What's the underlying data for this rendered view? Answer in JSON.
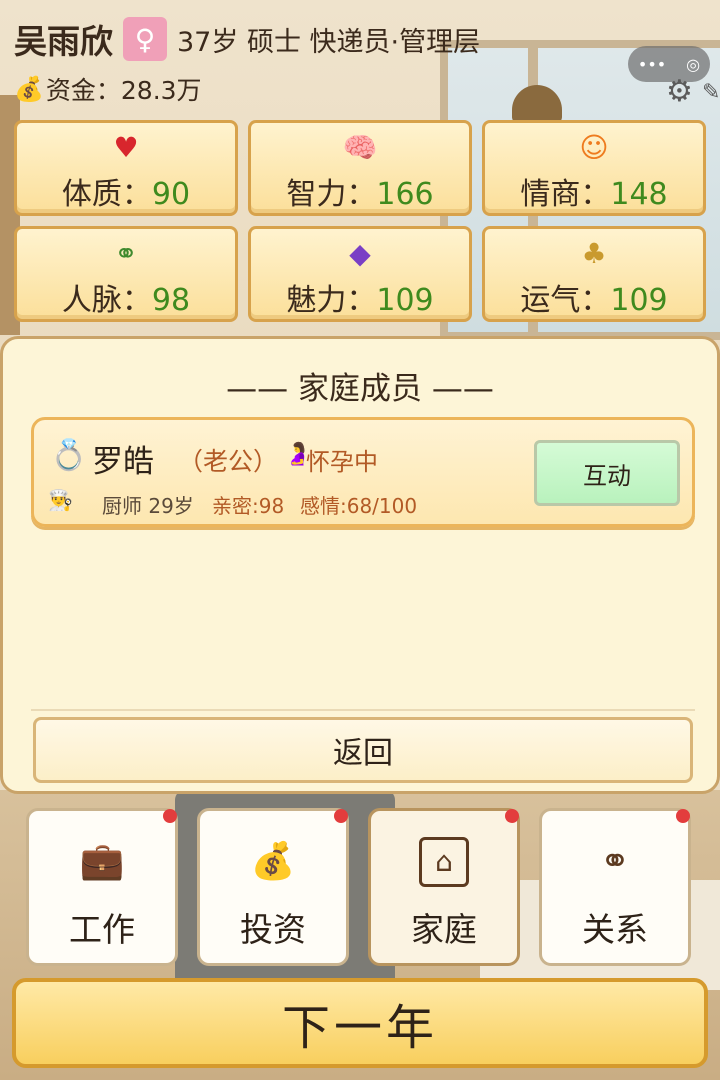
{
  "header": {
    "player_name": "吴雨欣",
    "gender_symbol": "♀",
    "player_info": "37岁 硕士 快递员·管理层",
    "funds": "资金：28.3万"
  },
  "stats": [
    {
      "icon": "♥",
      "label": "体质：",
      "value": "90",
      "icon_color": "#d8262d"
    },
    {
      "icon": "🧠",
      "label": "智力：",
      "value": "166",
      "icon_color": "#3b7fd0"
    },
    {
      "icon": "☺",
      "label": "情商：",
      "value": "148",
      "icon_color": "#ee7b1e"
    },
    {
      "icon": "⚭",
      "label": "人脉：",
      "value": "98",
      "icon_color": "#3f8a2e"
    },
    {
      "icon": "◆",
      "label": "魅力：",
      "value": "109",
      "icon_color": "#7a3fc5"
    },
    {
      "icon": "♣",
      "label": "运气：",
      "value": "109",
      "icon_color": "#c99a2e"
    }
  ],
  "family_panel": {
    "title": "—— 家庭成员 ——",
    "member": {
      "name": "罗皓",
      "relation": "（老公）",
      "status": "怀孕中",
      "job": "厨师",
      "age": "29岁",
      "intimacy": "亲密:98",
      "affection": "感情:68/100",
      "interact_label": "互动"
    },
    "back_label": "返回"
  },
  "nav": [
    {
      "icon": "briefcase-icon",
      "label": "工作"
    },
    {
      "icon": "money-bag-icon",
      "label": "投资"
    },
    {
      "icon": "house-icon",
      "label": "家庭"
    },
    {
      "icon": "people-icon",
      "label": "关系"
    }
  ],
  "next_year_label": "下一年",
  "colors": {
    "stat_value": "#3f8a1e",
    "accent": "#d59a2d",
    "badge": "#e33d3d"
  }
}
